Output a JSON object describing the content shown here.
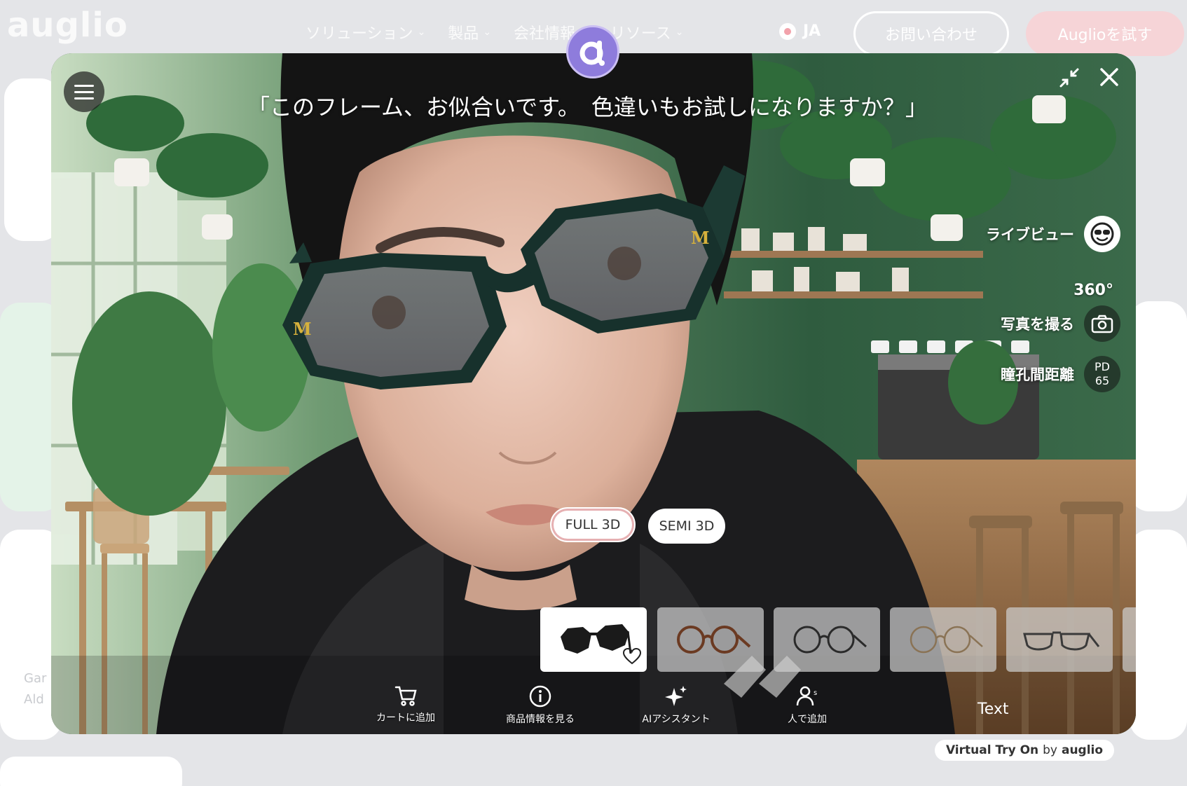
{
  "site": {
    "logo": "auglio",
    "nav": [
      {
        "label": "ソリューション"
      },
      {
        "label": "製品"
      },
      {
        "label": "会社情報"
      },
      {
        "label": "リソース"
      }
    ],
    "lang": "JA",
    "contact_label": "お問い合わせ",
    "try_label": "Auglioを試す",
    "side_text_1": "Gar",
    "side_text_2": "Ald"
  },
  "viewer": {
    "caption": "「このフレーム、お似合いです。　色違いもお試しになりますか？」",
    "side": {
      "live_view": "ライブビュー",
      "view_360": "360°",
      "take_photo": "写真を撮る",
      "pd_label": "瞳孔間距離",
      "pd_badge_title": "PD",
      "pd_value": "65"
    },
    "modes": {
      "full": "FULL 3D",
      "semi": "SEMI 3D"
    },
    "thumbnails": [
      {
        "name": "sunglasses-octagon-black",
        "selected": true,
        "favorite": false
      },
      {
        "name": "round-brown-frames",
        "selected": false
      },
      {
        "name": "round-dark-frames",
        "selected": false
      },
      {
        "name": "round-gold-frames",
        "selected": false
      },
      {
        "name": "aviator-dark-frames",
        "selected": false
      }
    ],
    "bottom_bar": {
      "cart": "カートに追加",
      "details": "商品情報を見る",
      "ai_assistant": "AIアシスタント",
      "ai_model": "人で追加",
      "text": "Text"
    }
  },
  "footer_brand": {
    "prefix": "Virtual Try On",
    "by": "by",
    "brand": "auglio"
  },
  "colors": {
    "accent_pink": "#f6d4d7",
    "badge_purple": "#8e7cdc",
    "frame_green": "#173530"
  }
}
